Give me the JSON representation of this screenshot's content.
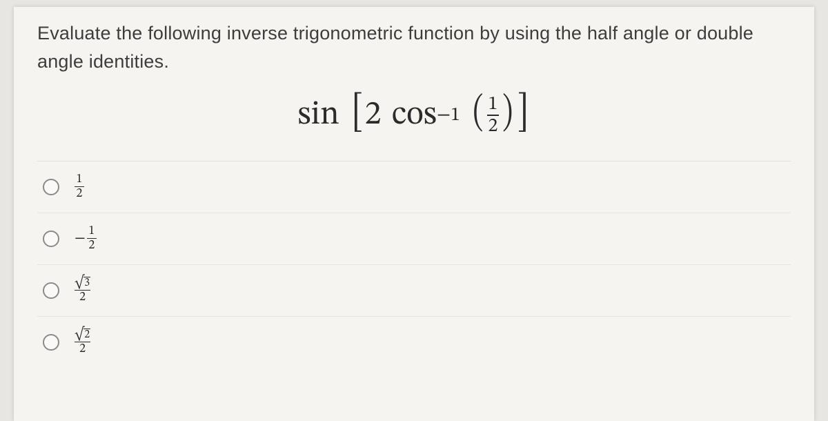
{
  "question": {
    "prompt": "Evaluate the following inverse trigonometric function by using the half angle or double angle identities.",
    "expression": {
      "outer_fn": "sin",
      "inner_coef": "2",
      "inner_fn": "cos",
      "inner_exp": "−1",
      "arg_num": "1",
      "arg_den": "2"
    }
  },
  "options": [
    {
      "type": "fraction",
      "sign": "",
      "num": "1",
      "den": "2"
    },
    {
      "type": "fraction",
      "sign": "−",
      "num": "1",
      "den": "2"
    },
    {
      "type": "sqrt_fraction",
      "sign": "",
      "rad": "3",
      "den": "2"
    },
    {
      "type": "sqrt_fraction",
      "sign": "",
      "rad": "2",
      "den": "2"
    }
  ]
}
